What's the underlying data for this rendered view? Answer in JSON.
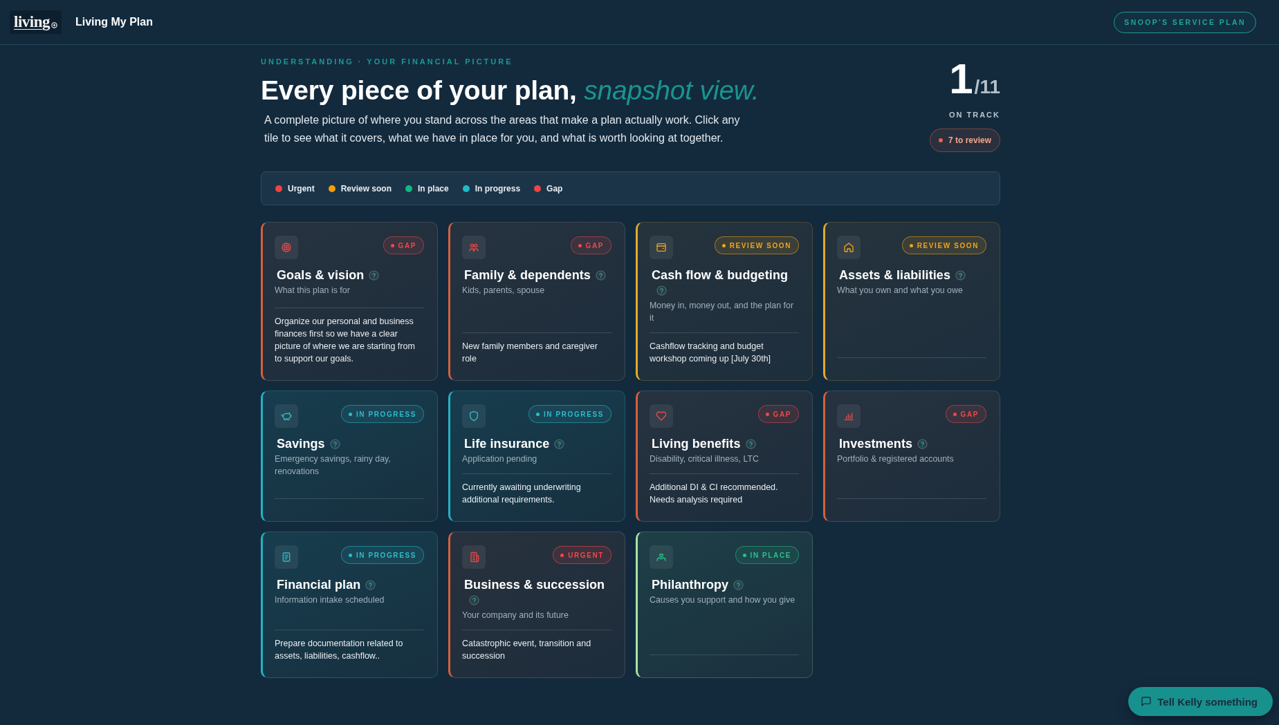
{
  "header": {
    "logo": "living",
    "title": "Living My Plan",
    "plan_button": "SNOOP'S SERVICE PLAN"
  },
  "intro": {
    "eyebrow": "UNDERSTANDING · YOUR FINANCIAL PICTURE",
    "title": "Every piece of your plan, *snapshot view.*",
    "description": "A complete picture of where you stand across the areas that make a plan actually work. Click any tile to see what it covers, what we have in place for you, and what is worth looking at together."
  },
  "progress": {
    "count": "1",
    "total": "/11",
    "label": "ON TRACK",
    "review": "7 to review"
  },
  "legend": [
    {
      "label": "Urgent",
      "color": "#ef4444"
    },
    {
      "label": "Review soon",
      "color": "#f59e0b"
    },
    {
      "label": "In place",
      "color": "#10b981"
    },
    {
      "label": "In progress",
      "color": "#22b8c8"
    },
    {
      "label": "Gap",
      "color": "#ef4444"
    }
  ],
  "cards": [
    {
      "kind": "gap",
      "badge": "GAP",
      "title": "Goals & vision",
      "subtitle": "What this plan is for",
      "note": "Organize our personal and business finances first so we have a clear picture of where we are starting from to support our goals."
    },
    {
      "kind": "gap",
      "badge": "GAP",
      "title": "Family & dependents",
      "subtitle": "Kids, parents, spouse",
      "note": "New family members and caregiver role"
    },
    {
      "kind": "review_soon",
      "badge": "REVIEW SOON",
      "title": "Cash flow & budgeting",
      "subtitle": "Money in, money out, and the plan for it",
      "note": "Cashflow tracking and budget workshop coming up [July 30th]"
    },
    {
      "kind": "review_soon",
      "badge": "REVIEW SOON",
      "title": "Assets & liabilities",
      "subtitle": "What you own and what you owe"
    },
    {
      "kind": "in_progress",
      "badge": "IN PROGRESS",
      "title": "Savings",
      "subtitle": "Emergency savings, rainy day, renovations"
    },
    {
      "kind": "in_progress",
      "badge": "IN PROGRESS",
      "title": "Life insurance",
      "subtitle": "Application pending",
      "note": "Currently awaiting underwriting additional requirements."
    },
    {
      "kind": "gap",
      "badge": "GAP",
      "title": "Living benefits",
      "subtitle": "Disability, critical illness, LTC",
      "note": "Additional DI & CI recommended. Needs analysis required"
    },
    {
      "kind": "gap",
      "badge": "GAP",
      "title": "Investments",
      "subtitle": "Portfolio & registered accounts"
    },
    {
      "kind": "in_progress",
      "badge": "IN PROGRESS",
      "title": "Financial plan",
      "subtitle": "Information intake scheduled",
      "note": "Prepare documentation related to assets, liabilities, cashflow.."
    },
    {
      "kind": "urgent",
      "badge": "URGENT",
      "title": "Business & succession",
      "subtitle": "Your company and its future",
      "note": "Catastrophic event, transition and succession"
    },
    {
      "kind": "in_place",
      "badge": "IN PLACE",
      "title": "Philanthropy",
      "subtitle": "Causes you support and how you give"
    }
  ],
  "feedback_button": "Tell Kelly something"
}
